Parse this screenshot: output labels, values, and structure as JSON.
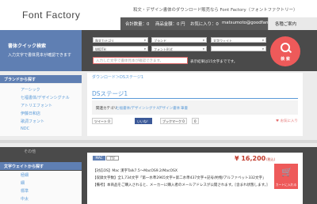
{
  "header": {
    "logo": "Font Factory",
    "tagline": "和文・デザイン書体のダウンロード販売なら Font Factory（フォントファクトリー）",
    "nav": [
      "合計数量：0",
      "商品金額：0 円",
      "お気に入り：0",
      "matsumoto@goodfarm-or-"
    ],
    "nav_icon": "user-icon",
    "register_label": "各種ご案内"
  },
  "search": {
    "title": "書体クイック検索",
    "subtitle": "入力文字で書体見本が確認できます",
    "selects": [
      "和文カテゴリ",
      "ブランド",
      "文字ウェイト",
      "WIDTH",
      "フォント形式",
      ""
    ],
    "keyword_placeholder": "入力した文字で書体見本が確認できます。",
    "keyword_note": "表示結果は15文字までです。",
    "button_label": "検 索",
    "button_icon": "search-icon"
  },
  "sidebar": {
    "brand_heading": "ブランドから探す",
    "brands": [
      "アーシック",
      "七福書体/デザインシグナル",
      "アトリエフォント",
      "伊藤日和店",
      "歌詞フォント",
      "NDC"
    ],
    "weight_heading": "文字ウェイトから探す",
    "weights": [
      "極細",
      "細",
      "標準",
      "中太"
    ],
    "misc": "その他"
  },
  "main": {
    "breadcrumb": "ダウンロード＞DSステージ1",
    "title": "DSステージ1",
    "related_label": "関連カテゴリ",
    "related_links": [
      "七福書体/デザインシグナル",
      "デザイン書体",
      "筆書"
    ],
    "social": [
      "ツイート 0",
      "いいね！",
      "ブックマーク 0",
      "0"
    ],
    "favorite": "♥ お気に入り"
  },
  "product": {
    "tags": [
      "MAC",
      "TTF"
    ],
    "price": "¥ 16,200",
    "price_unit": "(税込)",
    "lines": [
      "【対応OS】Mac 漢字Talk7.5〜MacOS9.2/MacOSX",
      "【収録文字数】全1,734文字「第一水準2965文字+第二水準437文字+記号/約物/アルファベット332文字」",
      "【備考】本商品をご購入されると、メーカーに購入者のメールアドレスが公開されます。[含まれ状態します。]"
    ],
    "cart_label": "カートに入れる",
    "cart_icon": "cart-icon"
  },
  "colors": {
    "accent": "#5f7fb3",
    "danger": "#ee5a5a",
    "link": "#5a9ad8",
    "dark": "#4a4a4a"
  }
}
